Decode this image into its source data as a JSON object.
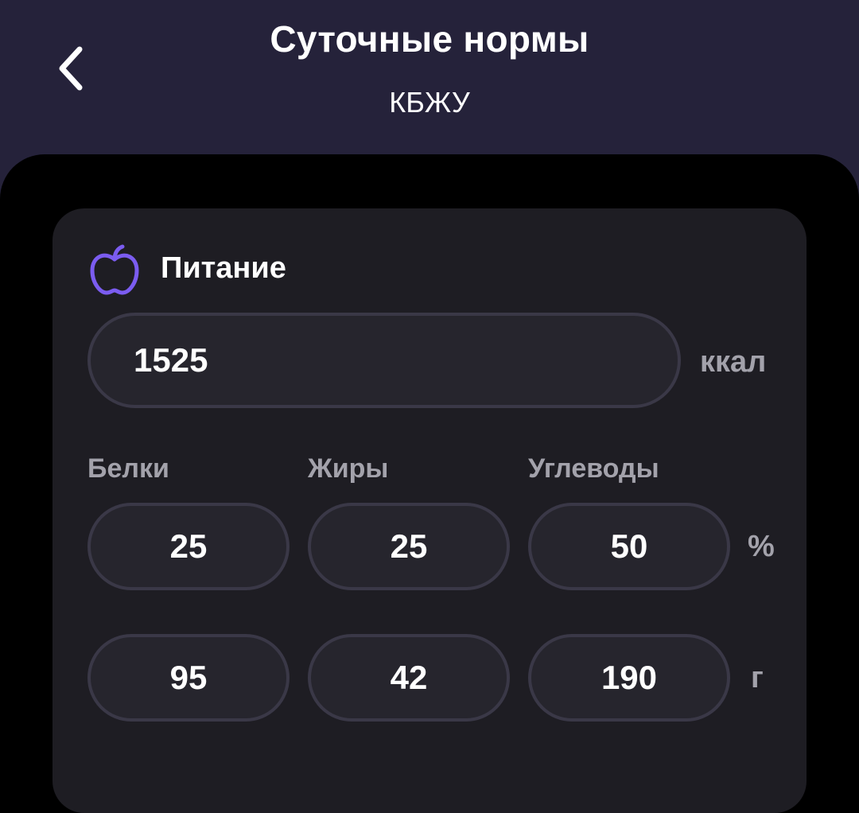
{
  "header": {
    "title": "Суточные нормы",
    "subtitle": "КБЖУ",
    "back_icon": "chevron-left-icon"
  },
  "nutrition": {
    "icon": "apple-icon",
    "accent_color": "#7b5cf0",
    "title": "Питание",
    "calories": {
      "value": "1525",
      "unit": "ккал"
    },
    "labels": {
      "protein": "Белки",
      "fat": "Жиры",
      "carbs": "Углеводы"
    },
    "percent": {
      "protein": "25",
      "fat": "25",
      "carbs": "50",
      "unit": "%"
    },
    "grams": {
      "protein": "95",
      "fat": "42",
      "carbs": "190",
      "unit": "г"
    }
  }
}
